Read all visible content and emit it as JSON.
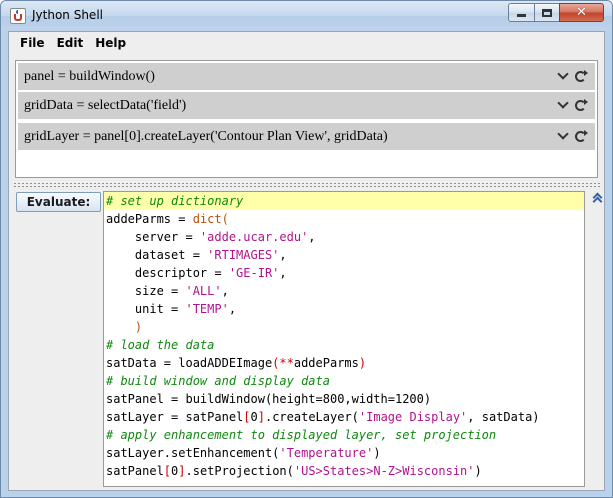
{
  "window": {
    "title": "Jython Shell",
    "close_glyph": "✕"
  },
  "menu": [
    "File",
    "Edit",
    "Help"
  ],
  "history": [
    {
      "text": "panel = buildWindow()",
      "icons": [
        "chevron-down-icon",
        "refresh-icon"
      ]
    },
    {
      "text": "gridData = selectData('field')",
      "icons": [
        "chevron-down-icon",
        "refresh-icon"
      ]
    },
    {
      "text": "gridLayer = panel[0].createLayer('Contour Plan View', gridData)",
      "icons": [
        "chevron-down-icon",
        "refresh-icon"
      ]
    }
  ],
  "evaluate_label": "Evaluate:",
  "code_lines": [
    [
      {
        "t": "# set up dictionary",
        "c": "comment"
      }
    ],
    [
      {
        "t": "addeParms = ",
        "c": "plain"
      },
      {
        "t": "dict",
        "c": "fn"
      },
      {
        "t": "(",
        "c": "fn"
      }
    ],
    [
      {
        "t": "    server = ",
        "c": "plain"
      },
      {
        "t": "'adde.ucar.edu'",
        "c": "str"
      },
      {
        "t": ",",
        "c": "plain"
      }
    ],
    [
      {
        "t": "    dataset = ",
        "c": "plain"
      },
      {
        "t": "'RTIMAGES'",
        "c": "str"
      },
      {
        "t": ",",
        "c": "plain"
      }
    ],
    [
      {
        "t": "    descriptor = ",
        "c": "plain"
      },
      {
        "t": "'GE-IR'",
        "c": "str"
      },
      {
        "t": ",",
        "c": "plain"
      }
    ],
    [
      {
        "t": "    size = ",
        "c": "plain"
      },
      {
        "t": "'ALL'",
        "c": "str"
      },
      {
        "t": ",",
        "c": "plain"
      }
    ],
    [
      {
        "t": "    unit = ",
        "c": "plain"
      },
      {
        "t": "'TEMP'",
        "c": "str"
      },
      {
        "t": ",",
        "c": "plain"
      }
    ],
    [
      {
        "t": "    )",
        "c": "fn"
      }
    ],
    [
      {
        "t": "# load the data",
        "c": "comment"
      }
    ],
    [
      {
        "t": "satData = loadADDEImage",
        "c": "plain"
      },
      {
        "t": "(**",
        "c": "op"
      },
      {
        "t": "addeParms",
        "c": "plain"
      },
      {
        "t": ")",
        "c": "op"
      }
    ],
    [
      {
        "t": "# build window and display data",
        "c": "comment"
      }
    ],
    [
      {
        "t": "satPanel = buildWindow(height=800,width=1200)",
        "c": "plain"
      }
    ],
    [
      {
        "t": "satLayer = satPanel",
        "c": "plain"
      },
      {
        "t": "[",
        "c": "op"
      },
      {
        "t": "0",
        "c": "plain"
      },
      {
        "t": "]",
        "c": "op"
      },
      {
        "t": ".createLayer(",
        "c": "plain"
      },
      {
        "t": "'Image Display'",
        "c": "str"
      },
      {
        "t": ", satData)",
        "c": "plain"
      }
    ],
    [
      {
        "t": "# apply enhancement to displayed layer, set projection",
        "c": "comment"
      }
    ],
    [
      {
        "t": "satLayer.setEnhancement(",
        "c": "plain"
      },
      {
        "t": "'Temperature'",
        "c": "str"
      },
      {
        "t": ")",
        "c": "plain"
      }
    ],
    [
      {
        "t": "satPanel",
        "c": "plain"
      },
      {
        "t": "[",
        "c": "op"
      },
      {
        "t": "0",
        "c": "plain"
      },
      {
        "t": "]",
        "c": "op"
      },
      {
        "t": ".setProjection(",
        "c": "plain"
      },
      {
        "t": "'US>States>N-Z>Wisconsin'",
        "c": "str"
      },
      {
        "t": ")",
        "c": "plain"
      }
    ]
  ]
}
